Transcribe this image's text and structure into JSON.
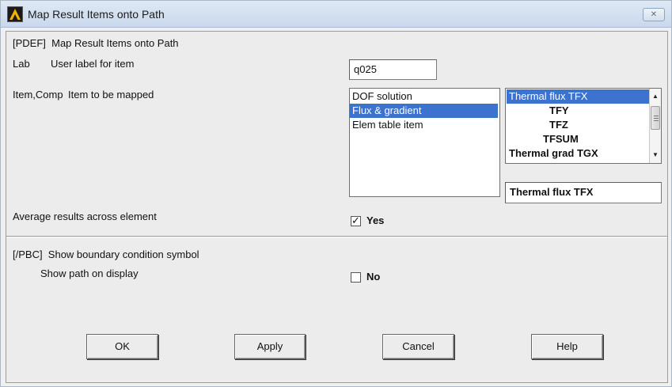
{
  "window": {
    "title": "Map Result Items onto Path",
    "close_glyph": "✕"
  },
  "dialog": {
    "header": "[PDEF]  Map Result Items onto Path",
    "lab": {
      "key": "Lab",
      "description": "User label for item",
      "value": "q025"
    },
    "item_comp": {
      "key": "Item,Comp",
      "description": "Item to be mapped",
      "item_list": [
        "DOF solution",
        "Flux & gradient",
        "Elem table item"
      ],
      "item_selected_index": 1,
      "comp_list": [
        "Thermal flux TFX",
        "TFY",
        "TFZ",
        "TFSUM",
        "Thermal grad TGX"
      ],
      "comp_selected_index": 0,
      "comp_value": "Thermal flux TFX"
    },
    "average": {
      "label": "Average results across element",
      "checked": true,
      "value_label": "Yes"
    },
    "pbc": {
      "header": "[/PBC]  Show boundary condition symbol",
      "show_path_label": "Show path on display",
      "checked": false,
      "value_label": "No"
    },
    "buttons": {
      "ok": "OK",
      "apply": "Apply",
      "cancel": "Cancel",
      "help": "Help"
    }
  }
}
